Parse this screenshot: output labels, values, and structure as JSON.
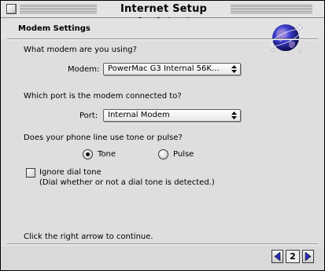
{
  "window": {
    "title": "Internet Setup Assistant"
  },
  "header": {
    "title": "Modem Settings",
    "icon": "globe-icon"
  },
  "modem": {
    "question": "What modem are you using?",
    "label": "Modem:",
    "selected": "PowerMac G3 Internal 56K..."
  },
  "port": {
    "question": "Which port is the modem connected to?",
    "label": "Port:",
    "selected": "Internal Modem"
  },
  "dial": {
    "question": "Does your phone line use tone or pulse?",
    "options": [
      {
        "label": "Tone",
        "selected": true
      },
      {
        "label": "Pulse",
        "selected": false
      }
    ]
  },
  "ignore_dial_tone": {
    "label": "Ignore dial tone",
    "description": "(Dial whether or not a dial tone is detected.)",
    "checked": false
  },
  "footer": {
    "instruction": "Click the right arrow to continue.",
    "page_number": "2"
  }
}
